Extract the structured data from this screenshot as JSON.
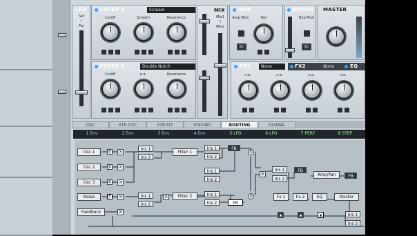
{
  "filter1": {
    "title": "FILTER 1",
    "mode": "Scream",
    "knobs": [
      "Cutoff",
      "Scream",
      "Resonance"
    ]
  },
  "f2": {
    "title": "+F2",
    "sub1": "Ser",
    "sub2": "I",
    "sub3": "Par"
  },
  "filter2": {
    "title": "FILTER 2",
    "mode": "Double Notch",
    "knobs": [
      "Cutoff",
      "n.a.",
      "Resonance"
    ]
  },
  "mix": {
    "title": "MIX",
    "sub1": "Mix1",
    "sub2": "I",
    "sub3": "Mix2"
  },
  "amp": {
    "title": "AMP",
    "mod": "Amp Mod",
    "pan": "Pan",
    "sc": "SC"
  },
  "bypass": {
    "title": "BYPASS",
    "mod": "Byp Mod",
    "sc": "SC"
  },
  "master": {
    "title": "MASTER"
  },
  "fx1": {
    "title": "FX1",
    "mode": "None",
    "knobs": [
      "n.a.",
      "n.a.",
      "n.a.",
      "n.a."
    ]
  },
  "fx2": {
    "title": "FX2",
    "mode": "None"
  },
  "eq": {
    "title": "EQ"
  },
  "tabs": [
    "OSC",
    "XTR OSC",
    "XTR FLT",
    "VOICING",
    "ROUTING",
    "GLOBAL"
  ],
  "sources": [
    "1 Env",
    "2 Env",
    "3 Env",
    "4 Env",
    "5 LFO",
    "6 LFO",
    "7 PERF",
    "8 STEP"
  ],
  "routing": {
    "osc1": "Osc 1",
    "osc2": "Osc 2",
    "osc3": "Osc 3",
    "noise": "Noise",
    "feedback": "Feedback",
    "b": "B",
    "ins1": "Ins 1",
    "ins2": "Ins 2",
    "filter1": "Filter 1",
    "filter2": "Filter 2",
    "fb": "FB",
    "amppan": "Amp/Pan",
    "fx1": "Fx 1",
    "fx2": "Fx 2",
    "eq": "EQ",
    "master": "Master"
  }
}
